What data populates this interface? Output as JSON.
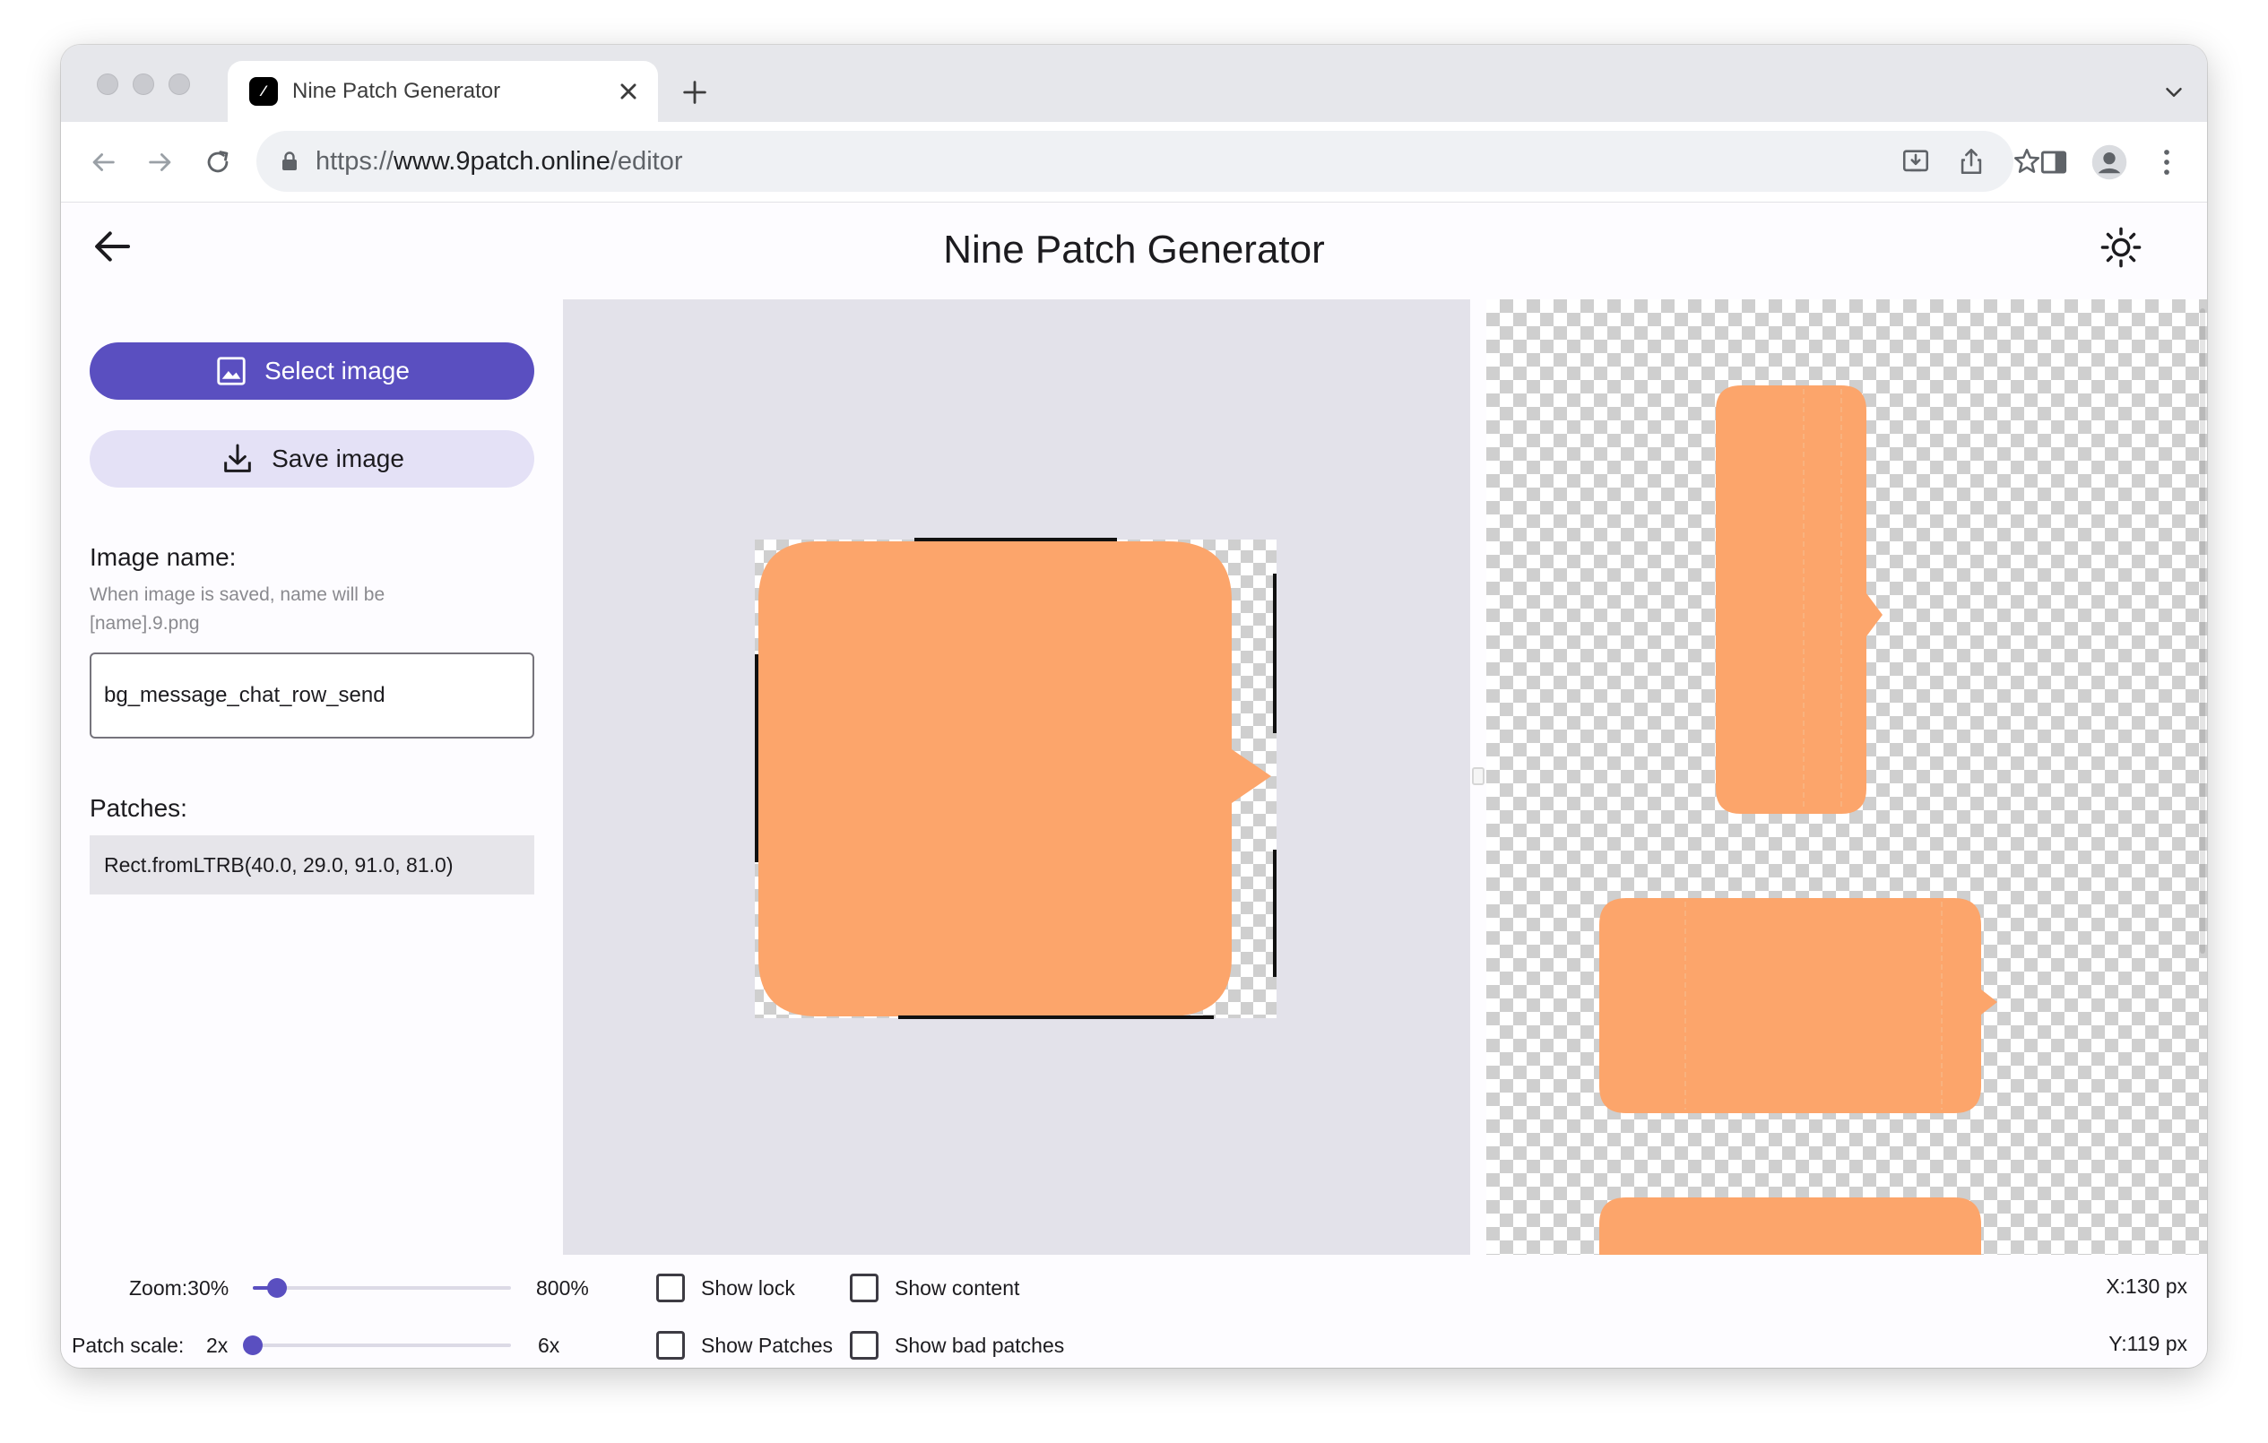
{
  "browser": {
    "tab_title": "Nine Patch Generator",
    "url_scheme": "https://",
    "url_host": "www.9patch.online",
    "url_path": "/editor"
  },
  "app": {
    "title": "Nine Patch Generator",
    "select_image_label": "Select image",
    "save_image_label": "Save image",
    "image_name_label": "Image name:",
    "image_name_helper": "When image is saved, name will be [name].9.png",
    "image_name_value": "bg_message_chat_row_send",
    "patches_label": "Patches:",
    "patches_value": "Rect.fromLTRB(40.0, 29.0, 91.0, 81.0)",
    "fill_color": "#fca56b",
    "accent_color": "#5a4fc0"
  },
  "controls": {
    "zoom_label": "Zoom:30%",
    "zoom_max": "800%",
    "zoom_value_percent": 30,
    "zoom_min_percent": 0,
    "zoom_max_percent": 800,
    "patch_scale_label": "Patch scale:",
    "patch_scale_value": "2x",
    "patch_scale_max": "6x",
    "patch_scale_fraction": 0,
    "show_lock": "Show lock",
    "show_content": "Show content",
    "show_patches": "Show Patches",
    "show_bad_patches": "Show bad patches",
    "show_lock_checked": false,
    "show_content_checked": false,
    "show_patches_checked": false,
    "show_bad_patches_checked": false,
    "x_coord": "X:130 px",
    "y_coord": "Y:119 px"
  }
}
